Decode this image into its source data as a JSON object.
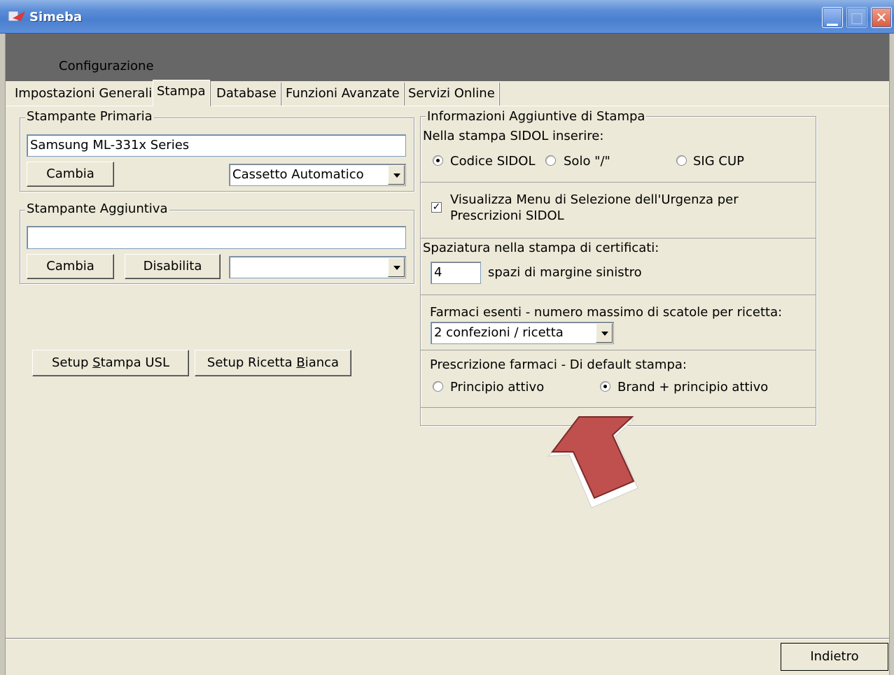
{
  "window": {
    "title": "Simeba"
  },
  "header": {
    "config_label": "Configurazione"
  },
  "tabs": [
    {
      "label": "Impostazioni Generali"
    },
    {
      "label": "Stampa"
    },
    {
      "label": "Database"
    },
    {
      "label": "Funzioni Avanzate"
    },
    {
      "label": "Servizi Online"
    }
  ],
  "primary_printer": {
    "title": "Stampante Primaria",
    "value": "Samsung ML-331x Series",
    "change_label": "Cambia",
    "tray": "Cassetto Automatico"
  },
  "additional_printer": {
    "title": "Stampante Aggiuntiva",
    "value": "",
    "change_label": "Cambia",
    "disable_label": "Disabilita",
    "tray": ""
  },
  "setup": {
    "usl_prefix": "Setup ",
    "usl_mnemonic": "S",
    "usl_suffix": "tampa USL",
    "ricetta_prefix": "Setup Ricetta ",
    "ricetta_mnemonic": "B",
    "ricetta_suffix": "ianca"
  },
  "info": {
    "title": "Informazioni Aggiuntive di Stampa",
    "sidol_label": "Nella stampa SIDOL inserire:",
    "sidol_options": [
      "Codice SIDOL",
      "Solo \"/\"",
      "SIG CUP"
    ],
    "sidol_selected": "Codice SIDOL",
    "urgency_line1": "Visualizza Menu di Selezione dell'Urgenza per",
    "urgency_line2": "Prescrizioni SIDOL",
    "urgency_checked": true,
    "spacing_label": "Spaziatura nella stampa di certificati:",
    "spacing_value": "4",
    "spacing_suffix": "spazi di margine sinistro",
    "exempt_label": "Farmaci esenti - numero massimo di scatole per ricetta:",
    "exempt_value": "2 confezioni / ricetta",
    "default_label": "Prescrizione farmaci - Di default stampa:",
    "default_options": [
      "Principio attivo",
      "Brand + principio attivo"
    ],
    "default_selected": "Brand + principio attivo"
  },
  "footer": {
    "back_label": "Indietro"
  },
  "colors": {
    "arrow_fill": "#c0504d",
    "titlebar": "#4a7fd0"
  }
}
